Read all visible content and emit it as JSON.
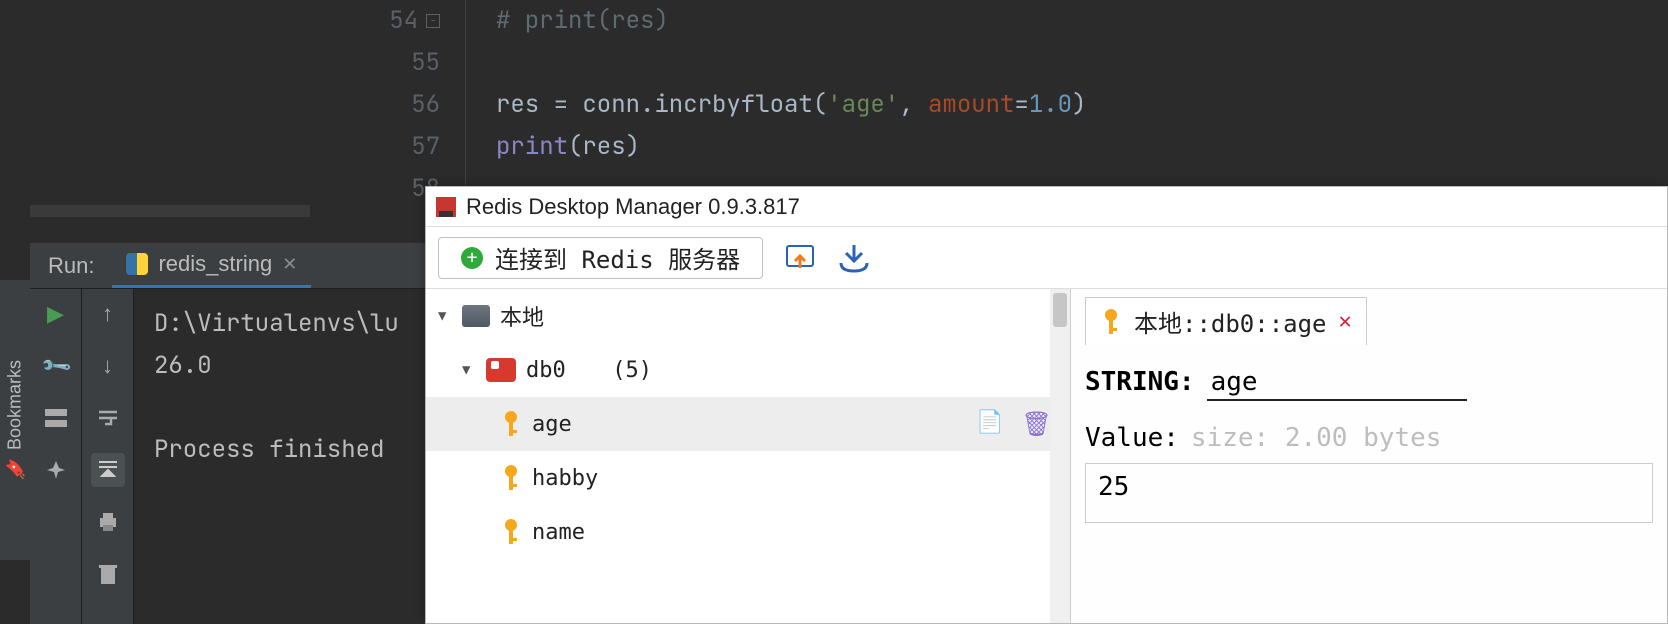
{
  "ide": {
    "gutter": [
      "54",
      "55",
      "56",
      "57",
      "58"
    ],
    "code_line54": "# print(res)",
    "code_line56_pre": "res = conn.incrbyfloat(",
    "code_line56_str": "'age'",
    "code_line56_kw": "amount",
    "code_line56_num": "1.0",
    "code_line57_fn": "print",
    "code_line57_arg": "(res)",
    "run_label": "Run:",
    "run_tab": "redis_string",
    "console_path": "D:\\Virtualenvs\\lu",
    "console_out": "26.0",
    "console_done": "Process finished ",
    "bookmarks": "Bookmarks"
  },
  "rdm": {
    "title": "Redis Desktop Manager 0.9.3.817",
    "connect": "连接到 Redis 服务器",
    "tree": {
      "server": "本地",
      "db": "db0",
      "db_count": "(5)",
      "keys": [
        "age",
        "habby",
        "name"
      ]
    },
    "detail": {
      "tab": "本地::db0::age",
      "type_label": "STRING:",
      "key_name": "age",
      "value_label": "Value:",
      "size_hint": "size: 2.00 bytes",
      "value": "25"
    }
  }
}
